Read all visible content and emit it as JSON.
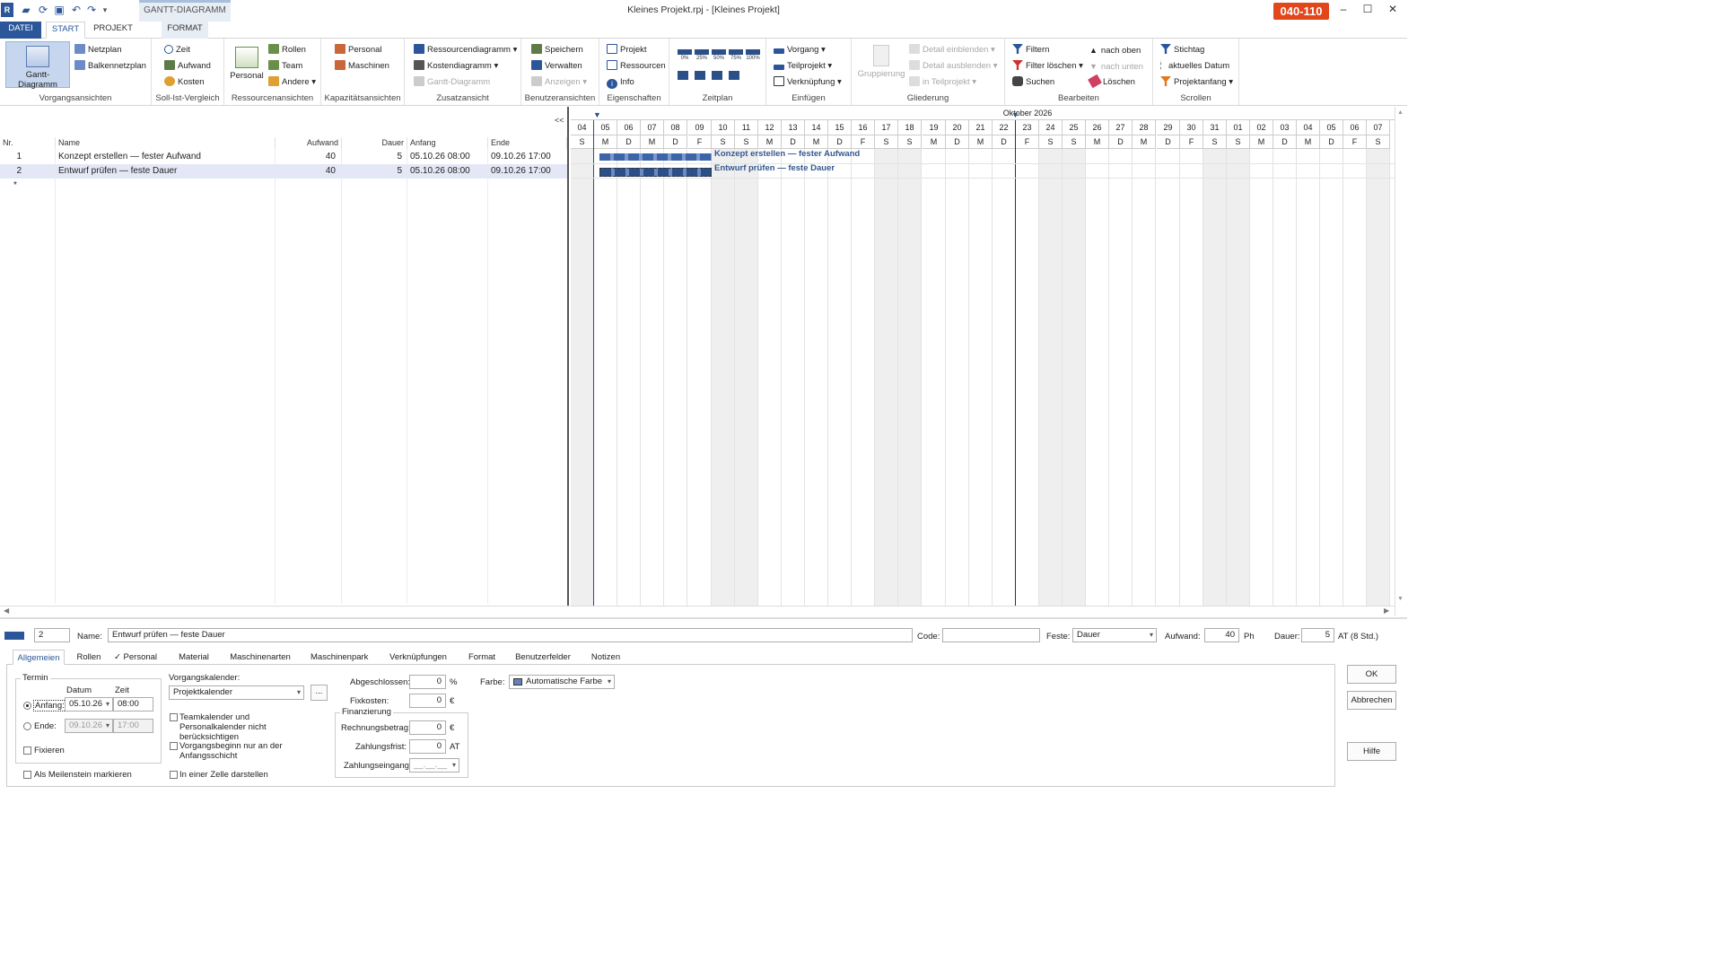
{
  "window": {
    "title": "Kleines Projekt.rpj - [Kleines Projekt]",
    "badge": "040-110",
    "context_group": "GANTT-DIAGRAMM"
  },
  "tabs": [
    {
      "label": "DATEI"
    },
    {
      "label": "START"
    },
    {
      "label": "PROJEKT"
    },
    {
      "label": "FORMAT"
    }
  ],
  "ribbon": {
    "vorgangsansichten": {
      "label": "Vorgangsansichten",
      "gantt": "Gantt-Diagramm",
      "netzplan": "Netzplan",
      "balken": "Balkennetzplan"
    },
    "sollist": {
      "label": "Soll-Ist-Vergleich",
      "zeit": "Zeit",
      "aufwand": "Aufwand",
      "kosten": "Kosten"
    },
    "ressourcen": {
      "label": "Ressourcenansichten",
      "personal": "Personal",
      "rollen": "Rollen",
      "team": "Team",
      "andere": "Andere"
    },
    "kapazitaet": {
      "label": "Kapazitätsansichten",
      "personal": "Personal",
      "maschinen": "Maschinen"
    },
    "zusatz": {
      "label": "Zusatzansicht",
      "rdiag": "Ressourcendiagramm",
      "kdiag": "Kostendiagramm",
      "gantt": "Gantt-Diagramm"
    },
    "benutzer": {
      "label": "Benutzeransichten",
      "speichern": "Speichern",
      "verwalten": "Verwalten",
      "anzeigen": "Anzeigen"
    },
    "eigenschaften": {
      "label": "Eigenschaften",
      "projekt": "Projekt",
      "ressourcen": "Ressourcen",
      "info": "Info"
    },
    "zeitplan": {
      "label": "Zeitplan",
      "z0": "0%",
      "z25": "25%",
      "z50": "50%",
      "z75": "75%",
      "z100": "100%"
    },
    "einfuegen": {
      "label": "Einfügen",
      "vorgang": "Vorgang",
      "teilprojekt": "Teilprojekt",
      "verknuepfung": "Verknüpfung"
    },
    "gliederung": {
      "label": "Gliederung",
      "gruppierung": "Gruppierung",
      "detail_ein": "Detail einblenden",
      "detail_aus": "Detail ausblenden",
      "in_teilprojekt": "in Teilprojekt"
    },
    "bearbeiten": {
      "label": "Bearbeiten",
      "filtern": "Filtern",
      "filter_loeschen": "Filter löschen",
      "suchen": "Suchen",
      "nach_oben": "nach oben",
      "nach_unten": "nach unten",
      "loeschen": "Löschen"
    },
    "scrollen": {
      "label": "Scrollen",
      "stichtag": "Stichtag",
      "aktuelles": "aktuelles Datum",
      "projektanfang": "Projektanfang"
    }
  },
  "table": {
    "collapse": "<<",
    "columns": {
      "nr": "Nr.",
      "name": "Name",
      "aufwand": "Aufwand",
      "dauer": "Dauer",
      "anfang": "Anfang",
      "ende": "Ende"
    },
    "rows": [
      {
        "nr": "1",
        "name": "Konzept erstellen — fester Aufwand",
        "aufwand": "40",
        "dauer": "5",
        "anfang": "05.10.26 08:00",
        "ende": "09.10.26 17:00"
      },
      {
        "nr": "2",
        "name": "Entwurf prüfen — feste Dauer",
        "aufwand": "40",
        "dauer": "5",
        "anfang": "05.10.26 08:00",
        "ende": "09.10.26 17:00"
      }
    ],
    "new_row": "*"
  },
  "gantt": {
    "month": "Oktober 2026",
    "days": [
      "04",
      "05",
      "06",
      "07",
      "08",
      "09",
      "10",
      "11",
      "12",
      "13",
      "14",
      "15",
      "16",
      "17",
      "18",
      "19",
      "20",
      "21",
      "22",
      "23",
      "24",
      "25",
      "26",
      "27",
      "28",
      "29",
      "30",
      "31",
      "01",
      "02",
      "03",
      "04",
      "05",
      "06",
      "07"
    ],
    "weekdays": [
      "S",
      "M",
      "D",
      "M",
      "D",
      "F",
      "S",
      "S",
      "M",
      "D",
      "M",
      "D",
      "F",
      "S",
      "S",
      "M",
      "D",
      "M",
      "D",
      "F",
      "S",
      "S",
      "M",
      "D",
      "M",
      "D",
      "F",
      "S",
      "S",
      "M",
      "D",
      "M",
      "D",
      "F",
      "S"
    ],
    "bars": [
      {
        "label": "Konzept erstellen — fester Aufwand",
        "start_day": 1,
        "duration_days": 5
      },
      {
        "label": "Entwurf prüfen — feste Dauer",
        "start_day": 1,
        "duration_days": 5
      }
    ]
  },
  "detail": {
    "nr": "2",
    "name_label": "Name:",
    "name_value": "Entwurf prüfen — feste Dauer",
    "code_label": "Code:",
    "code_value": "",
    "feste_label": "Feste:",
    "feste_value": "Dauer",
    "aufwand_label": "Aufwand:",
    "aufwand_value": "40",
    "aufwand_unit": "Ph",
    "dauer_label": "Dauer:",
    "dauer_value": "5",
    "dauer_unit": "AT (8 Std.)",
    "tabs": [
      "Allgemeien",
      "Rollen",
      "✓ Personal",
      "Material",
      "Maschinenarten",
      "Maschinenpark",
      "Verknüpfungen",
      "Format",
      "Benutzerfelder",
      "Notizen"
    ],
    "termin": {
      "legend": "Termin",
      "datum": "Datum",
      "zeit": "Zeit",
      "anfang_label": "Anfang:",
      "anfang_datum": "05.10.26",
      "anfang_zeit": "08:00",
      "ende_label": "Ende:",
      "ende_datum": "09.10.26",
      "ende_zeit": "17:00",
      "fixieren": "Fixieren"
    },
    "meilenstein": "Als Meilenstein markieren",
    "kalender_label": "Vorgangskalender:",
    "kalender_value": "Projektkalender",
    "kalender_btn": "...",
    "team_cb": "Teamkalender und Personalkalender nicht berücksichtigen",
    "beginn_cb": "Vorgangsbeginn nur an der Anfangsschicht",
    "zelle_cb": "In einer Zelle darstellen",
    "abgeschlossen_label": "Abgeschlossen:",
    "abgeschlossen_value": "0",
    "abgeschlossen_unit": "%",
    "fixkosten_label": "Fixkosten:",
    "fixkosten_value": "0",
    "fixkosten_unit": "€",
    "finanzierung": "Finanzierung",
    "rechnung_label": "Rechnungsbetrag:",
    "rechnung_value": "0",
    "rechnung_unit": "€",
    "zahlungsfrist_label": "Zahlungsfrist:",
    "zahlungsfrist_value": "0",
    "zahlungsfrist_unit": "AT",
    "zahlungseingang_label": "Zahlungseingang:",
    "zahlungseingang_value": "__.__.__",
    "farbe_label": "Farbe:",
    "farbe_value": "Automatische Farbe",
    "ok": "OK",
    "abbrechen": "Abbrechen",
    "hilfe": "Hilfe"
  },
  "colors": {
    "accent": "#2b579a",
    "bar": "#3d63a8",
    "badge": "#e2461b"
  }
}
